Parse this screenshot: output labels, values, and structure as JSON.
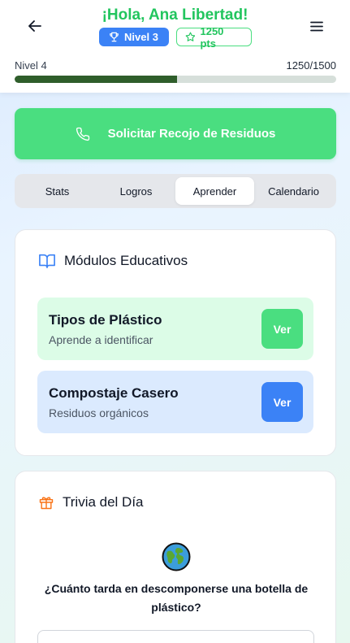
{
  "header": {
    "greeting": "¡Hola, Ana Libertad!",
    "level_badge": "Nivel 3",
    "points_badge": "1250 pts",
    "back_icon": "arrow-left-icon",
    "menu_icon": "hamburger-menu-icon"
  },
  "progress": {
    "label": "Nivel 4",
    "value_text": "1250/1500",
    "fraction": 0.505
  },
  "cta": {
    "label": "Solicitar Recojo de Residuos",
    "icon": "phone-icon"
  },
  "tabs": [
    {
      "label": "Stats"
    },
    {
      "label": "Logros"
    },
    {
      "label": "Aprender"
    },
    {
      "label": "Calendario"
    }
  ],
  "active_tab": "Aprender",
  "modules_card": {
    "title": "Módulos Educativos",
    "icon": "book-open-icon",
    "items": [
      {
        "title": "Tipos de Plástico",
        "subtitle": "Aprende a identificar",
        "button": "Ver"
      },
      {
        "title": "Compostaje Casero",
        "subtitle": "Residuos orgánicos",
        "button": "Ver"
      }
    ]
  },
  "trivia_card": {
    "title": "Trivia del Día",
    "icon": "gift-icon",
    "question_icon": "globe-icon",
    "question": "¿Cuánto tarda en descomponerse una botella de plástico?"
  },
  "colors": {
    "green": "#22c55e",
    "green_light": "#4ade80",
    "blue": "#3b82f6",
    "progress_fill": "#2f5e2b",
    "orange": "#f97316"
  }
}
